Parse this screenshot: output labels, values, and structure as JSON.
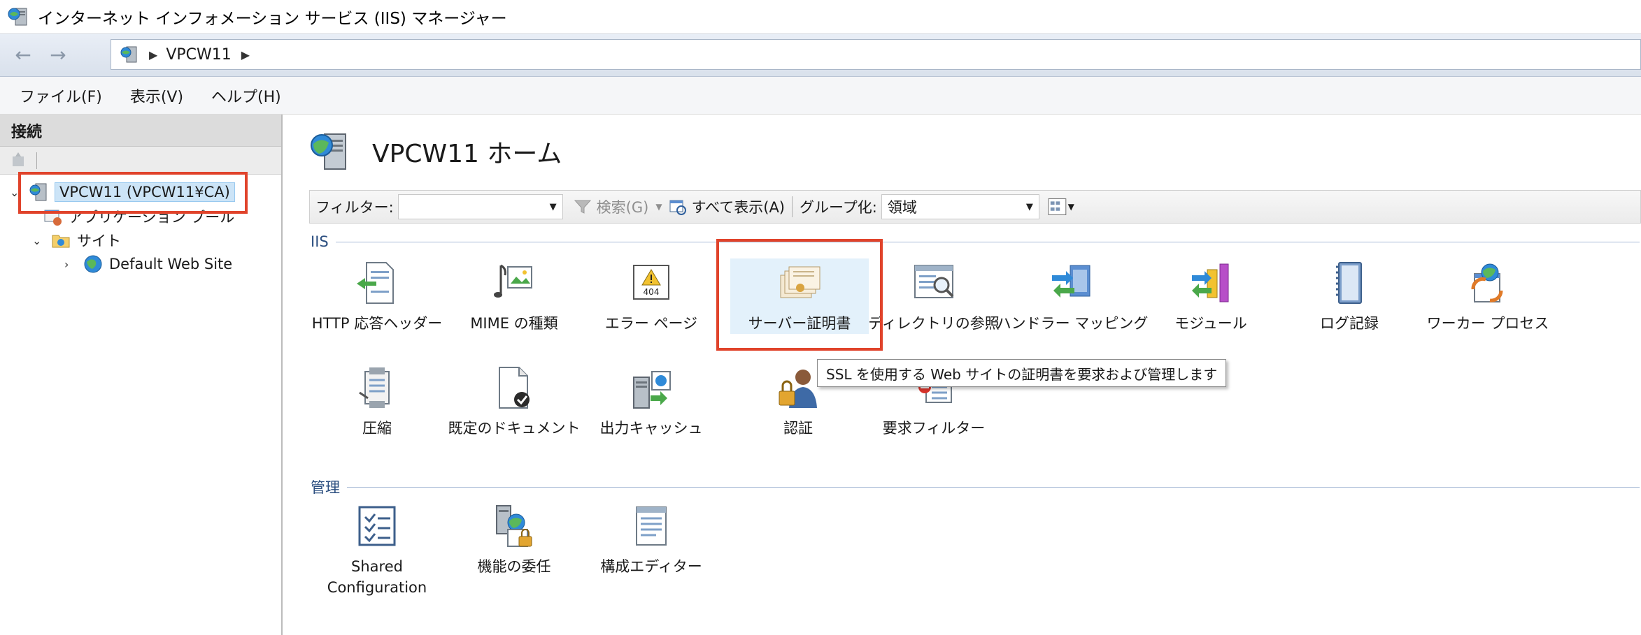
{
  "window": {
    "title": "インターネット インフォメーション サービス (IIS) マネージャー",
    "icon": "iis-manager-icon"
  },
  "address_bar": {
    "breadcrumb": [
      "VPCW11"
    ]
  },
  "menu": {
    "items": [
      "ファイル(F)",
      "表示(V)",
      "ヘルプ(H)"
    ]
  },
  "connections": {
    "header": "接続",
    "tree": [
      {
        "label": "VPCW11 (VPCW11¥CA)",
        "icon": "server-icon",
        "expanded": true,
        "selected": true
      },
      {
        "label": "アプリケーション プール",
        "icon": "app-pool-icon"
      },
      {
        "label": "サイト",
        "icon": "sites-folder-icon",
        "expanded": true
      },
      {
        "label": "Default Web Site",
        "icon": "globe-icon",
        "expanded": false
      }
    ]
  },
  "main": {
    "title": "VPCW11 ホーム",
    "filter": {
      "label": "フィルター:",
      "search_label": "検索(G)",
      "show_all_label": "すべて表示(A)",
      "group_by_label": "グループ化:",
      "group_by_value": "領域"
    },
    "groups": [
      {
        "name": "IIS",
        "features": [
          {
            "label": "HTTP 応答ヘッダー",
            "icon": "http-response-headers-icon"
          },
          {
            "label": "MIME の種類",
            "icon": "mime-types-icon"
          },
          {
            "label": "エラー ページ",
            "icon": "error-pages-icon"
          },
          {
            "label": "サーバー証明書",
            "icon": "server-certificates-icon",
            "highlighted": true
          },
          {
            "label": "ディレクトリの参照",
            "icon": "directory-browsing-icon"
          },
          {
            "label": "ハンドラー マッピング",
            "icon": "handler-mappings-icon"
          },
          {
            "label": "モジュール",
            "icon": "modules-icon"
          },
          {
            "label": "ログ記録",
            "icon": "logging-icon"
          },
          {
            "label": "ワーカー プロセス",
            "icon": "worker-processes-icon"
          },
          {
            "label": "圧縮",
            "icon": "compression-icon"
          },
          {
            "label": "既定のドキュメント",
            "icon": "default-document-icon"
          },
          {
            "label": "出力キャッシュ",
            "icon": "output-caching-icon"
          },
          {
            "label": "認証",
            "icon": "authentication-icon"
          },
          {
            "label": "要求フィルター",
            "icon": "request-filtering-icon"
          }
        ]
      },
      {
        "name": "管理",
        "features": [
          {
            "label_line1": "Shared",
            "label_line2": "Configuration",
            "icon": "shared-configuration-icon"
          },
          {
            "label": "機能の委任",
            "icon": "feature-delegation-icon"
          },
          {
            "label": "構成エディター",
            "icon": "configuration-editor-icon"
          }
        ]
      }
    ],
    "tooltip": "SSL を使用する Web サイトの証明書を要求および管理します"
  },
  "colors": {
    "highlight_border": "#e0432b",
    "selected_bg": "#cce4f7",
    "group_header": "#2c4f80"
  }
}
